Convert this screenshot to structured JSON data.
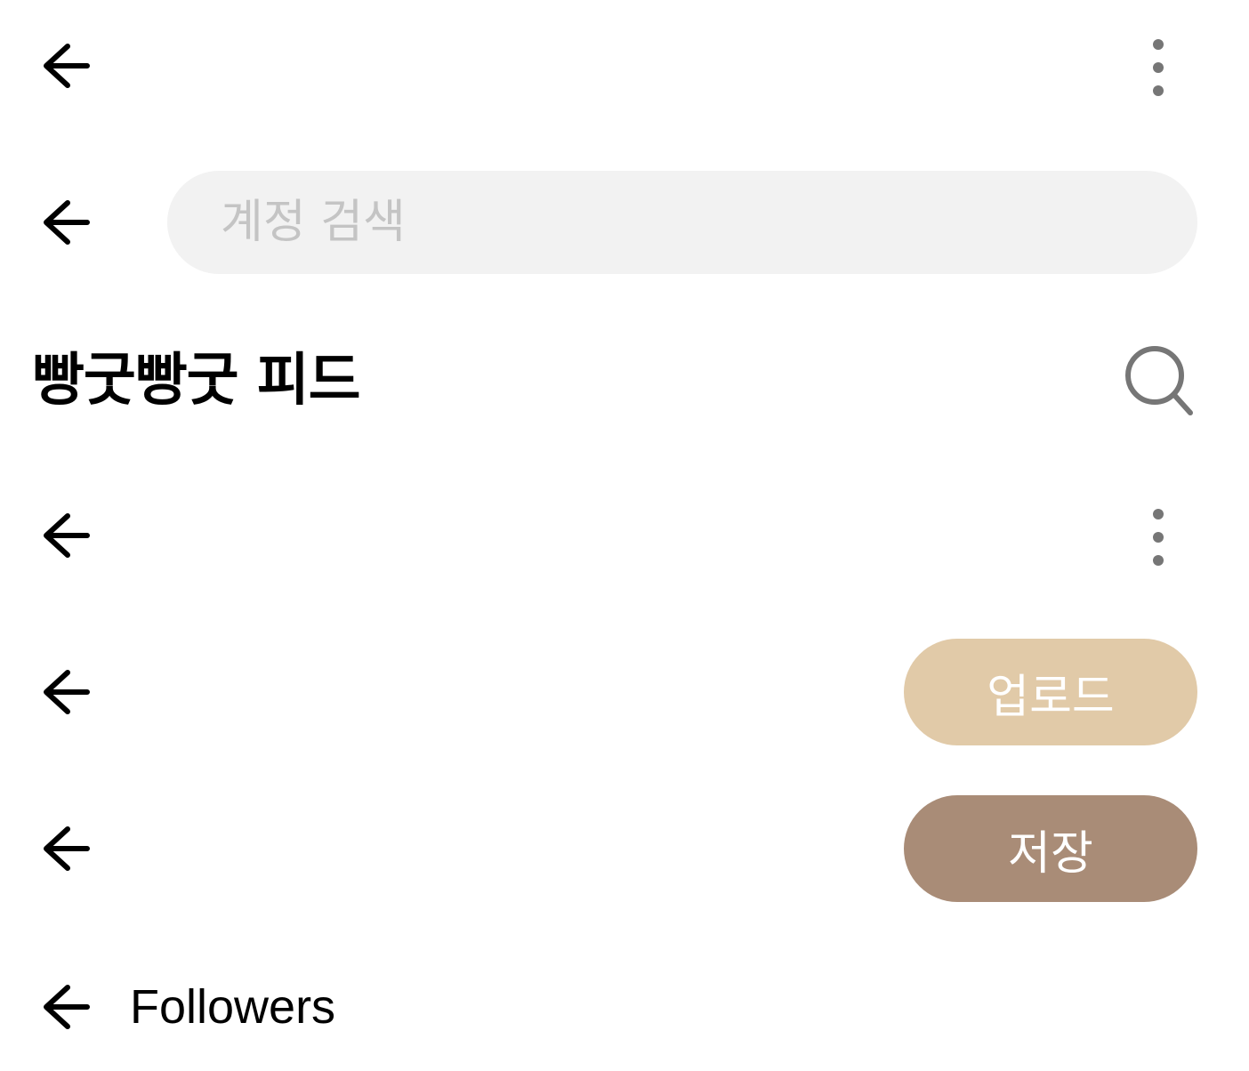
{
  "colors": {
    "text_primary": "#000000",
    "icon_gray": "#767676",
    "search_bg": "#f2f2f2",
    "placeholder": "#c4c4c4",
    "upload_button_bg": "#e1caa8",
    "save_button_bg": "#a98c77",
    "button_text": "#ffffff"
  },
  "icons": {
    "back": "arrow-left-icon",
    "more": "more-vertical-icon",
    "search": "search-icon"
  },
  "search_header": {
    "search_placeholder": "계정 검색"
  },
  "feed_header": {
    "title": "빵굿빵굿 피드"
  },
  "upload_header": {
    "upload_label": "업로드"
  },
  "save_header": {
    "save_label": "저장"
  },
  "followers_header": {
    "title": "Followers"
  }
}
